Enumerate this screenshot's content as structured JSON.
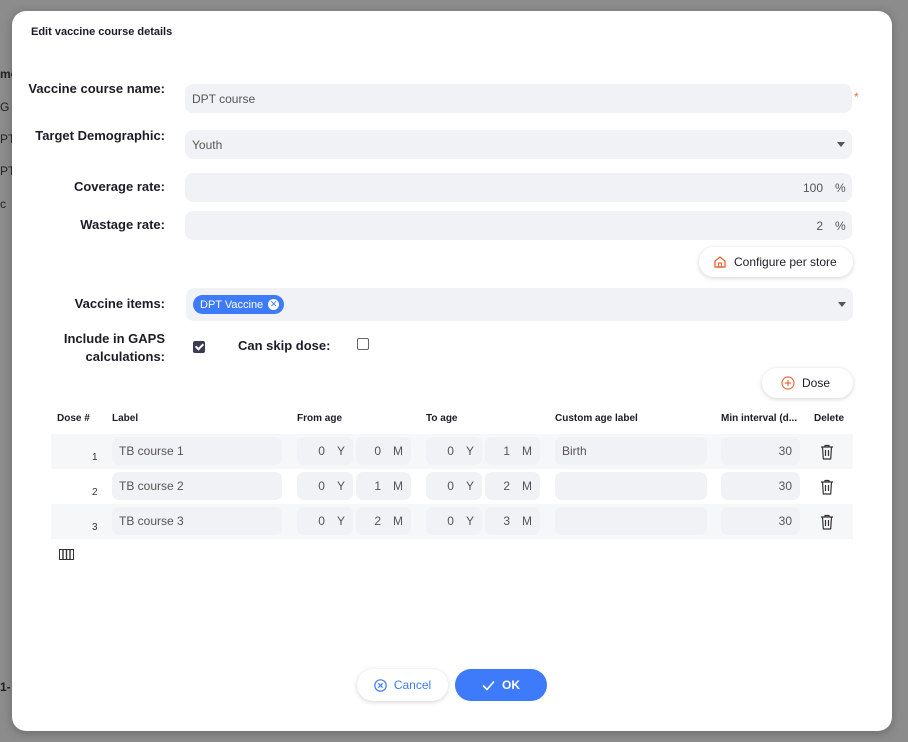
{
  "background": {
    "fragments": [
      "me",
      "G",
      "PT",
      "PT",
      "c",
      "1-"
    ]
  },
  "dialog": {
    "title": "Edit vaccine course details",
    "fields": {
      "name": {
        "label": "Vaccine course name:",
        "value": "DPT course",
        "required_mark": "*"
      },
      "demographic": {
        "label": "Target Demographic:",
        "value": "Youth"
      },
      "coverage": {
        "label": "Coverage rate:",
        "value": "100",
        "unit": "%"
      },
      "wastage": {
        "label": "Wastage rate:",
        "value": "2",
        "unit": "%"
      },
      "configure_button": "Configure per store",
      "items": {
        "label": "Vaccine items:",
        "chips": [
          "DPT Vaccine"
        ]
      },
      "gaps": {
        "label": "Include in GAPS calculations:",
        "checked": true
      },
      "skip": {
        "label": "Can skip dose:",
        "checked": false
      }
    },
    "add_dose_button": "Dose",
    "table": {
      "headers": [
        "Dose #",
        "Label",
        "From age",
        "To age",
        "Custom age label",
        "Min interval (d...",
        "Delete"
      ],
      "year_unit": "Y",
      "month_unit": "M",
      "rows": [
        {
          "dose": "1",
          "label": "TB course 1",
          "from_y": "0",
          "from_m": "0",
          "to_y": "0",
          "to_m": "1",
          "custom": "Birth",
          "interval": "30"
        },
        {
          "dose": "2",
          "label": "TB course 2",
          "from_y": "0",
          "from_m": "1",
          "to_y": "0",
          "to_m": "2",
          "custom": "",
          "interval": "30"
        },
        {
          "dose": "3",
          "label": "TB course 3",
          "from_y": "0",
          "from_m": "2",
          "to_y": "0",
          "to_m": "3",
          "custom": "",
          "interval": "30"
        }
      ]
    },
    "footer": {
      "cancel": "Cancel",
      "ok": "OK"
    }
  },
  "colors": {
    "accent": "#3e7bfa",
    "required": "#e96c3d",
    "checkbox": "#3b3b54"
  }
}
